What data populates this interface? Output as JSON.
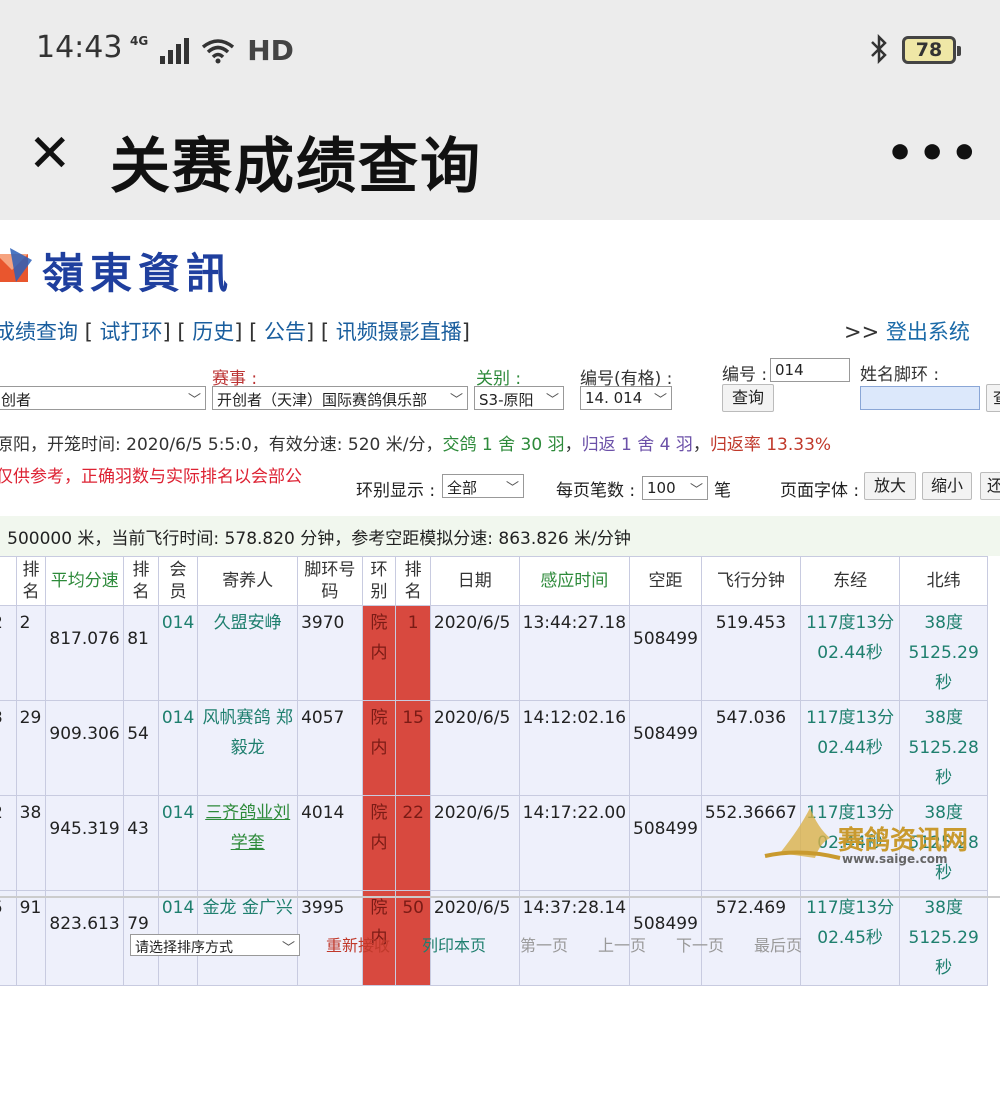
{
  "status": {
    "time": "14:43",
    "network": "4G",
    "hd": "HD",
    "battery": "78"
  },
  "appbar": {
    "title": "关赛成绩查询"
  },
  "site": {
    "logo_text": "嶺東資訊",
    "nav": [
      "成绩查询",
      "试打环",
      "历史",
      "公告",
      "讯频摄影直播"
    ],
    "logout_prefix": ">>",
    "logout": "登出系统"
  },
  "filters": {
    "org_value": "创者",
    "race_label": "赛事",
    "race_value": "开创者（天津）国际赛鸽俱乐部",
    "stage_label": "关别",
    "stage_value": "S3-原阳",
    "code_label": "编号(有格)",
    "code_value": "14. 014",
    "id_label": "编号",
    "id_value": "014",
    "query_button": "查询",
    "name_ring_label": "姓名脚环",
    "ring_display_label": "环别显示",
    "ring_display_value": "全部",
    "per_page_label": "每页笔数",
    "per_page_value": "100",
    "per_page_unit": "笔",
    "font_label": "页面字体",
    "zoom_in": "放大",
    "zoom_out": "缩小",
    "restore": "还"
  },
  "info": {
    "line1_a": "原阳，开笼时间: 2020/6/5 5:5:0，有效分速: 520 米/分，",
    "line1_b": "交鸽 1 舍 30 羽",
    "line1_c": "，",
    "line1_d": "归返 1 舍 4 羽",
    "line1_e": "，",
    "line1_f": "归返率 13.33%",
    "line2": "仅供参考，正确羽数与实际排名以会部公",
    "line3": ": 500000 米，当前飞行时间: 578.820 分钟，参考空距模拟分速: 863.826 米/分钟"
  },
  "table": {
    "headers": [
      "",
      "排名",
      "平均分速",
      "排名",
      "会员",
      "寄养人",
      "脚环号码",
      "环别",
      "排名",
      "日期",
      "感应时间",
      "空距",
      "飞行分钟",
      "东经",
      "北纬"
    ],
    "rows": [
      {
        "c0": "2",
        "rank1": "2",
        "avg_speed": "817.076",
        "rank2": "81",
        "member": "014",
        "owner": "久盟安峥",
        "ring": "3970",
        "ring_type": "院内",
        "rank3": "1",
        "date": "2020/6/5",
        "time": "13:44:27.18",
        "distance": "508499",
        "minutes": "519.453",
        "lon": "117度13分02.44秒",
        "lat": "38度5125.29秒"
      },
      {
        "c0": "3",
        "rank1": "29",
        "avg_speed": "909.306",
        "rank2": "54",
        "member": "014",
        "owner": "风帆赛鸽 郑毅龙",
        "ring": "4057",
        "ring_type": "院内",
        "rank3": "15",
        "date": "2020/6/5",
        "time": "14:12:02.16",
        "distance": "508499",
        "minutes": "547.036",
        "lon": "117度13分02.44秒",
        "lat": "38度5125.28秒"
      },
      {
        "c0": "2",
        "rank1": "38",
        "avg_speed": "945.319",
        "rank2": "43",
        "member": "014",
        "owner": "三齐鸽业刘学奎",
        "ring": "4014",
        "ring_type": "院内",
        "rank3": "22",
        "date": "2020/6/5",
        "time": "14:17:22.00",
        "distance": "508499",
        "minutes": "552.36667",
        "lon": "117度13分02.44秒",
        "lat": "38度5125.28秒"
      },
      {
        "c0": "5",
        "rank1": "91",
        "avg_speed": "823.613",
        "rank2": "79",
        "member": "014",
        "owner": "金龙 金广兴",
        "ring": "3995",
        "ring_type": "院内",
        "rank3": "50",
        "date": "2020/6/5",
        "time": "14:37:28.14",
        "distance": "508499",
        "minutes": "572.469",
        "lon": "117度13分02.45秒",
        "lat": "38度5125.29秒"
      }
    ]
  },
  "footer": {
    "sort_placeholder": "请选择排序方式",
    "reload": "重新接收",
    "print": "列印本页",
    "first": "第一页",
    "prev": "上一页",
    "next": "下一页",
    "last": "最后页"
  },
  "watermark": {
    "text": "赛鸽资讯网",
    "url": "www.saige.com"
  },
  "colors": {
    "red_cell": "#d8493f",
    "link_blue": "#1a5e9e",
    "green": "#2d8a3a",
    "logo_blue": "#1f3f9e"
  }
}
